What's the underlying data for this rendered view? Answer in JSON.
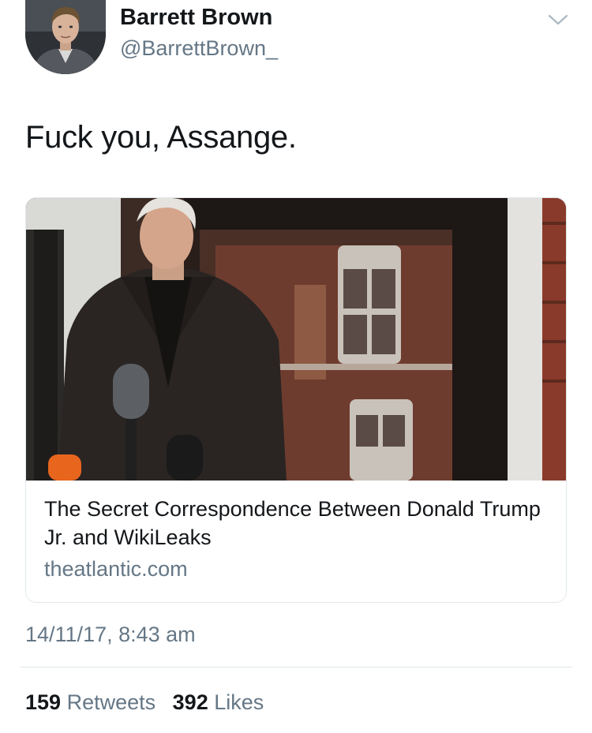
{
  "author": {
    "display_name": "Barrett Brown",
    "handle": "@BarrettBrown_"
  },
  "tweet": {
    "text": "Fuck you, Assange."
  },
  "card": {
    "title": "The Secret Correspondence Between Donald Trump Jr. and WikiLeaks",
    "domain": "theatlantic.com"
  },
  "timestamp": "14/11/17, 8:43 am",
  "stats": {
    "retweets_count": "159",
    "retweets_label": "Retweets",
    "likes_count": "392",
    "likes_label": "Likes"
  },
  "icons": {
    "menu": "chevron-down-icon"
  },
  "colors": {
    "text_primary": "#14171a",
    "text_secondary": "#657786",
    "border": "#e1e8ed"
  }
}
